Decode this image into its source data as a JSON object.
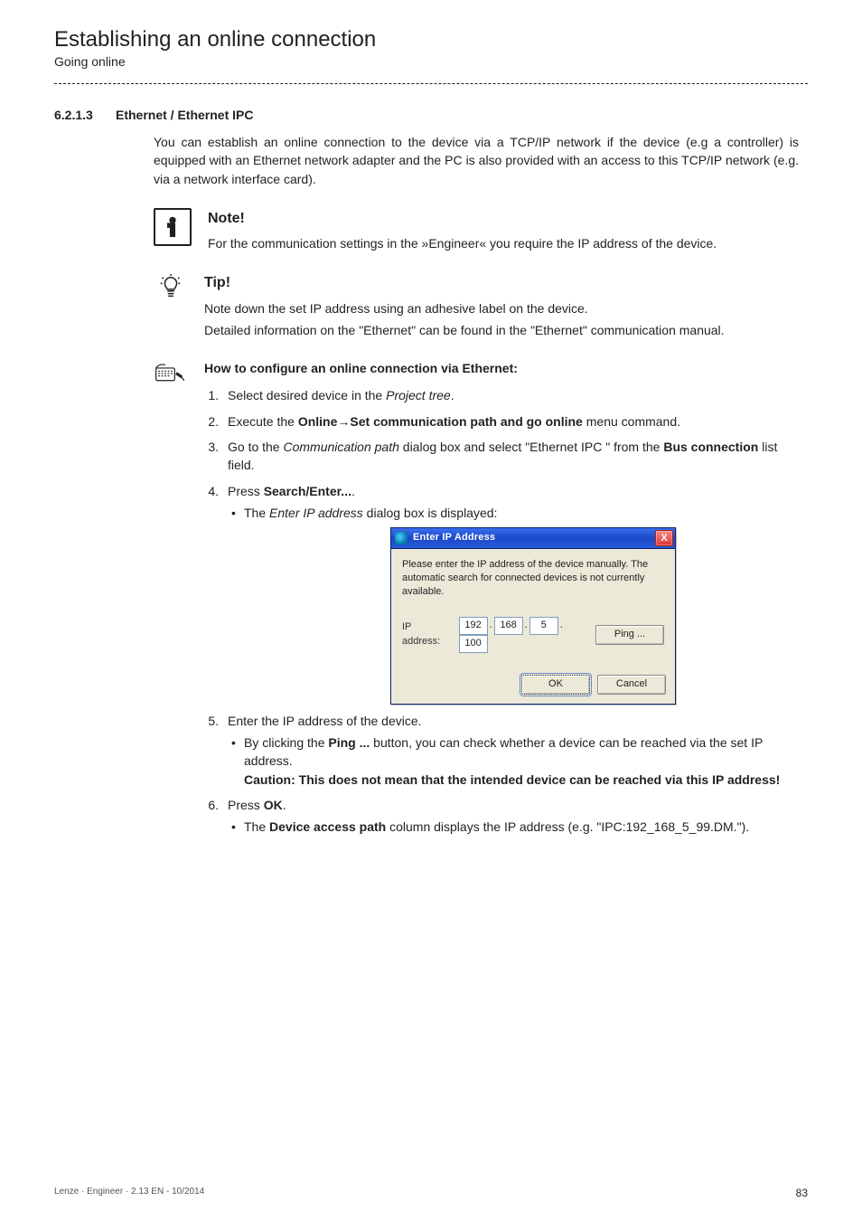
{
  "running_head": {
    "title": "Establishing an online connection",
    "subtitle": "Going online"
  },
  "section": {
    "number": "6.2.1.3",
    "name": "Ethernet / Ethernet IPC"
  },
  "intro": "You can establish an online connection to the device via a TCP/IP network if the device (e.g a controller) is equipped with an Ethernet network adapter and the PC is also provided with an access to this TCP/IP network (e.g. via a network interface card).",
  "note": {
    "head": "Note!",
    "body": "For the communication settings in the »Engineer« you require the IP address of the device."
  },
  "tip": {
    "head": "Tip!",
    "line1": "Note down the set IP address using an adhesive label on the device.",
    "line2": "Detailed information on the \"Ethernet\" can be found in the \"Ethernet\" communication manual."
  },
  "procedure_head": "How to configure an online connection via Ethernet:",
  "steps": {
    "s1_pre": "Select desired device in the ",
    "s1_it": "Project tree",
    "s1_post": ".",
    "s2_pre": "Execute the  ",
    "s2_b1": "Online",
    "s2_arrow": "→",
    "s2_b2": "Set communication path and go online",
    "s2_post": " menu command.",
    "s3_pre": "Go to the ",
    "s3_it": "Communication path",
    "s3_mid": " dialog box and select \"Ethernet IPC \" from the ",
    "s3_b": "Bus connection",
    "s3_post": " list field.",
    "s4_pre": "Press ",
    "s4_b": "Search/Enter...",
    "s4_post": ".",
    "s4_sub_pre": "The ",
    "s4_sub_it": "Enter IP address",
    "s4_sub_post": " dialog box is displayed:",
    "s5": "Enter the IP address of the device.",
    "s5_sub_pre": "By clicking the ",
    "s5_sub_b": "Ping ...",
    "s5_sub_post": " button, you can check whether a device can be reached via the set IP address.",
    "s5_caution": "Caution: This does not mean that the intended device can be reached via this IP address!",
    "s6_pre": "Press ",
    "s6_b": "OK",
    "s6_post": ".",
    "s6_sub_pre": "The ",
    "s6_sub_b": "Device access path",
    "s6_sub_post": " column displays the IP address (e.g. \"IPC:192_168_5_99.DM.\")."
  },
  "dialog": {
    "title": "Enter IP Address",
    "message": "Please enter the IP address of the device manually. The automatic search for connected devices is not currently available.",
    "ip_label": "IP address:",
    "octets": [
      "192",
      "168",
      "5",
      "100"
    ],
    "ping": "Ping ...",
    "ok": "OK",
    "cancel": "Cancel",
    "close_x": "X"
  },
  "footer": {
    "left": "Lenze · Engineer · 2.13 EN - 10/2014",
    "right": "83"
  }
}
